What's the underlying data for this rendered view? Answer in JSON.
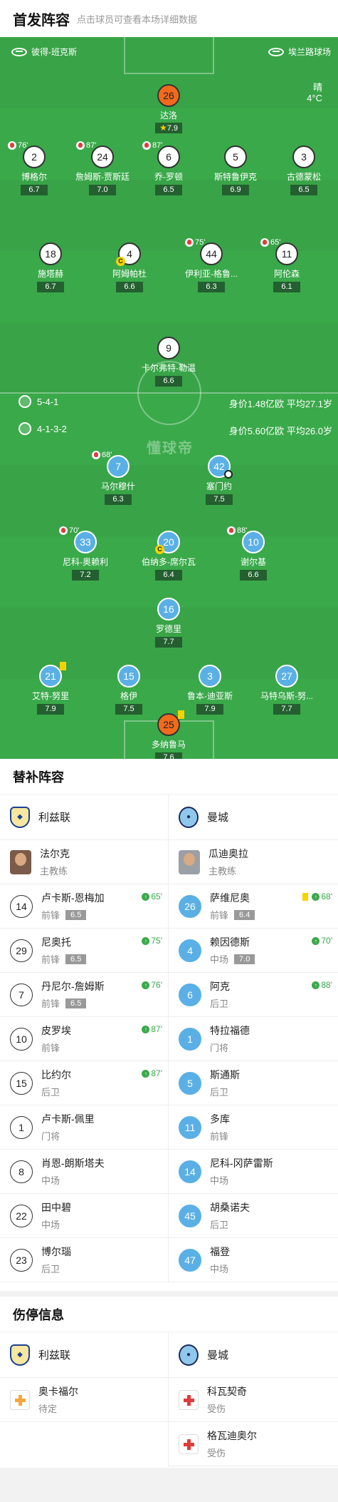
{
  "header": {
    "title": "首发阵容",
    "subtitle": "点击球员可查看本场详细数据"
  },
  "pitch": {
    "referee": "彼得-班克斯",
    "stadium": "埃兰路球场",
    "weather": "晴",
    "temperature": "4°C",
    "watermark": "懂球帝",
    "home_formation": "5-4-1",
    "home_value": "身价1.48亿欧",
    "home_age": "平均27.1岁",
    "away_formation": "4-1-3-2",
    "away_value": "身价5.60亿欧",
    "away_age": "平均26.0岁"
  },
  "home_players": [
    {
      "num": "26",
      "name": "达洛",
      "rating": "7.9",
      "style": "o",
      "star": true
    },
    {
      "num": "2",
      "name": "博格尔",
      "rating": "6.7",
      "style": "w",
      "sub": "76'"
    },
    {
      "num": "24",
      "name": "詹姆斯-贾斯廷",
      "rating": "7.0",
      "style": "w",
      "sub": "87'"
    },
    {
      "num": "6",
      "name": "乔-罗顿",
      "rating": "6.5",
      "style": "w",
      "sub": "87'"
    },
    {
      "num": "5",
      "name": "斯特鲁伊克",
      "rating": "6.9",
      "style": "w"
    },
    {
      "num": "3",
      "name": "古德蒙松",
      "rating": "6.5",
      "style": "w"
    },
    {
      "num": "18",
      "name": "施塔赫",
      "rating": "6.7",
      "style": "w"
    },
    {
      "num": "4",
      "name": "阿姆帕杜",
      "rating": "6.6",
      "style": "w",
      "captain": true
    },
    {
      "num": "44",
      "name": "伊利亚-格鲁...",
      "rating": "6.3",
      "style": "w",
      "sub": "75'"
    },
    {
      "num": "11",
      "name": "阿伦森",
      "rating": "6.1",
      "style": "w",
      "sub": "65'"
    },
    {
      "num": "9",
      "name": "卡尔弗特-勒温",
      "rating": "6.6",
      "style": "w"
    }
  ],
  "away_players": [
    {
      "num": "7",
      "name": "马尔穆什",
      "rating": "6.3",
      "style": "b",
      "sub": "68'"
    },
    {
      "num": "42",
      "name": "塞门约",
      "rating": "7.5",
      "style": "b",
      "goal": true
    },
    {
      "num": "33",
      "name": "尼科-奥赖利",
      "rating": "7.2",
      "style": "b",
      "sub": "70'"
    },
    {
      "num": "20",
      "name": "伯纳多-席尔瓦",
      "rating": "6.4",
      "style": "b",
      "captain": true
    },
    {
      "num": "10",
      "name": "谢尔基",
      "rating": "6.6",
      "style": "b",
      "sub": "88'"
    },
    {
      "num": "16",
      "name": "罗德里",
      "rating": "7.7",
      "style": "b"
    },
    {
      "num": "21",
      "name": "艾特-努里",
      "rating": "7.9",
      "style": "b",
      "card": true
    },
    {
      "num": "15",
      "name": "格伊",
      "rating": "7.5",
      "style": "b"
    },
    {
      "num": "3",
      "name": "鲁本-迪亚斯",
      "rating": "7.9",
      "style": "b"
    },
    {
      "num": "27",
      "name": "马特乌斯-努...",
      "rating": "7.7",
      "style": "b"
    },
    {
      "num": "25",
      "name": "多纳鲁马",
      "rating": "7.6",
      "style": "o",
      "card": true
    }
  ],
  "subs": {
    "title": "替补阵容",
    "home_team": "利兹联",
    "away_team": "曼城",
    "home_coach": {
      "name": "法尔克",
      "role": "主教练"
    },
    "away_coach": {
      "name": "瓜迪奥拉",
      "role": "主教练"
    },
    "home": [
      {
        "num": "14",
        "name": "卢卡斯-恩梅加",
        "pos": "前锋",
        "rating": "6.5",
        "in": "65'"
      },
      {
        "num": "29",
        "name": "尼奥托",
        "pos": "前锋",
        "rating": "6.5",
        "in": "75'"
      },
      {
        "num": "7",
        "name": "丹尼尔-詹姆斯",
        "pos": "前锋",
        "rating": "6.5",
        "in": "76'"
      },
      {
        "num": "10",
        "name": "皮罗埃",
        "pos": "前锋",
        "in": "87'"
      },
      {
        "num": "15",
        "name": "比约尔",
        "pos": "后卫",
        "in": "87'"
      },
      {
        "num": "1",
        "name": "卢卡斯-佩里",
        "pos": "门将"
      },
      {
        "num": "8",
        "name": "肖恩-朗斯塔夫",
        "pos": "中场"
      },
      {
        "num": "22",
        "name": "田中碧",
        "pos": "中场"
      },
      {
        "num": "23",
        "name": "博尔瑙",
        "pos": "后卫"
      }
    ],
    "away": [
      {
        "num": "26",
        "name": "萨维尼奥",
        "pos": "前锋",
        "rating": "6.4",
        "in": "68'",
        "card": true
      },
      {
        "num": "4",
        "name": "赖因德斯",
        "pos": "中场",
        "rating": "7.0",
        "in": "70'"
      },
      {
        "num": "6",
        "name": "阿克",
        "pos": "后卫",
        "in": "88'"
      },
      {
        "num": "1",
        "name": "特拉福德",
        "pos": "门将"
      },
      {
        "num": "5",
        "name": "斯通斯",
        "pos": "后卫"
      },
      {
        "num": "11",
        "name": "多库",
        "pos": "前锋"
      },
      {
        "num": "14",
        "name": "尼科-冈萨雷斯",
        "pos": "中场"
      },
      {
        "num": "45",
        "name": "胡桑诺夫",
        "pos": "后卫"
      },
      {
        "num": "47",
        "name": "福登",
        "pos": "中场"
      }
    ]
  },
  "injuries": {
    "title": "伤停信息",
    "home_team": "利兹联",
    "away_team": "曼城",
    "home": [
      {
        "name": "奥卡福尔",
        "status": "待定"
      }
    ],
    "away": [
      {
        "name": "科瓦契奇",
        "status": "受伤"
      },
      {
        "name": "格瓦迪奥尔",
        "status": "受伤"
      }
    ]
  }
}
